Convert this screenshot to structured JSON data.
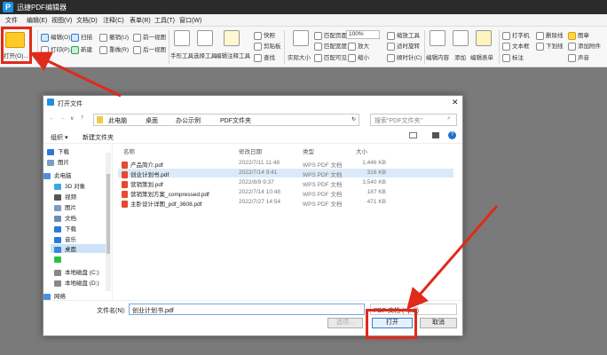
{
  "app": {
    "title": "迅捷PDF编辑器",
    "logo_letter": "P"
  },
  "menu": [
    "文件",
    "编辑(E)",
    "视图(V)",
    "文档(D)",
    "注释(C)",
    "表单(R)",
    "工具(T)",
    "窗口(W)"
  ],
  "ribbon": {
    "open_label": "打开(O)...",
    "items": [
      "编辑(O)",
      "扫描",
      "打印(P)...",
      "新建",
      "撤销(U)",
      "重做(R)",
      "前一视图",
      "后一视图",
      "手形工具",
      "选择工具",
      "编辑注释工具",
      "快照",
      "剪贴板",
      "查找",
      "实际大小",
      "匹配页面",
      "匹配宽度",
      "匹配可见",
      "100%",
      "缩小",
      "放大",
      "缩放工具",
      "适时旋转",
      "顺时针(C)",
      "编辑内容",
      "添加",
      "编辑表单",
      "打字机",
      "文本框",
      "标注",
      "删除线",
      "下划线",
      "图章",
      "添加附件",
      "声音"
    ]
  },
  "dialog": {
    "title": "打开文件",
    "breadcrumb": [
      "此电脑",
      "桌面",
      "办公示例",
      "PDF文件夹"
    ],
    "search_placeholder": "搜索\"PDF文件夹\"",
    "organize": "组织 ▾",
    "new_folder": "新建文件夹",
    "nav": [
      {
        "label": "下载",
        "color": "#2a7bd6"
      },
      {
        "label": "图片",
        "color": "#7a9cc6"
      },
      {
        "label": "此电脑",
        "color": "#4a8fe0"
      },
      {
        "label": "3D 对象",
        "color": "#3da6e0"
      },
      {
        "label": "视频",
        "color": "#555"
      },
      {
        "label": "图片",
        "color": "#7a9cc6"
      },
      {
        "label": "文档",
        "color": "#6a8fb0"
      },
      {
        "label": "下载",
        "color": "#2a7bd6"
      },
      {
        "label": "音乐",
        "color": "#2a7bd6"
      },
      {
        "label": "桌面",
        "color": "#3a86d6"
      },
      {
        "label": "",
        "color": "#2fbf3f"
      },
      {
        "label": "本地磁盘 (C:)",
        "color": "#888"
      },
      {
        "label": "本地磁盘 (D:)",
        "color": "#888"
      },
      {
        "label": "网络",
        "color": "#4a8fe0"
      }
    ],
    "columns": [
      "名称",
      "修改日期",
      "类型",
      "大小"
    ],
    "files": [
      {
        "name": "产品简介.pdf",
        "date": "2022/7/11 11:48",
        "type": "WPS PDF 文档",
        "size": "1,446 KB"
      },
      {
        "name": "创业计划书.pdf",
        "date": "2022/7/14 9:41",
        "type": "WPS PDF 文档",
        "size": "316 KB"
      },
      {
        "name": "营销策划.pdf",
        "date": "2022/8/9 9:37",
        "type": "WPS PDF 文档",
        "size": "3,540 KB"
      },
      {
        "name": "营销策划方案_compressed.pdf",
        "date": "2022/7/14 10:48",
        "type": "WPS PDF 文档",
        "size": "187 KB"
      },
      {
        "name": "主卧设计详图_pdf_3608.pdf",
        "date": "2022/7/27 14:54",
        "type": "WPS PDF 文档",
        "size": "471 KB"
      }
    ],
    "filename_label": "文件名(N):",
    "filename_value": "创业计划书.pdf",
    "filetype_value": "PDF 文档 (*.pdf)",
    "options_button": "选项...",
    "open_button": "打开",
    "cancel_button": "取消"
  },
  "colors": {
    "highlight": "#e02a1a",
    "titlebar": "#2b2b2b",
    "selection": "#dbeaf8"
  }
}
